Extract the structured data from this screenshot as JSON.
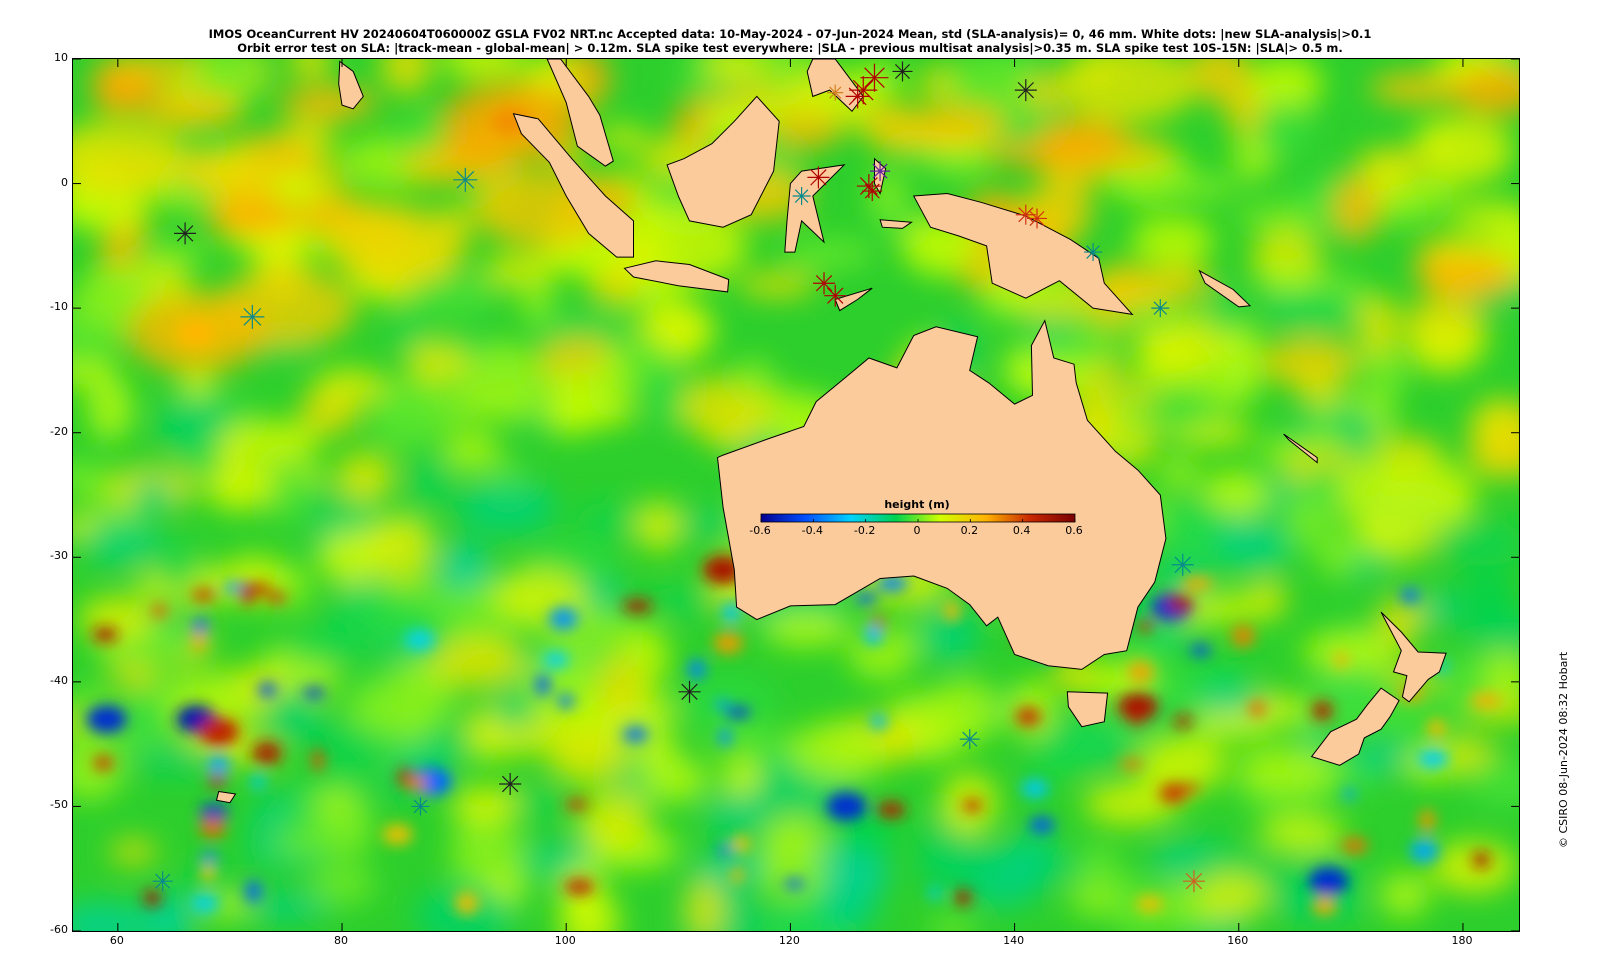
{
  "title": {
    "line1": "IMOS OceanCurrent HV 20240604T060000Z GSLA FV02 NRT.nc  Accepted data: 10-May-2024 - 07-Jun-2024 Mean, std (SLA-analysis)= 0, 46 mm. White dots: |new SLA-analysis|>0.1",
    "line2": "Orbit error test on SLA: |track-mean  - global-mean| > 0.12m.  SLA spike test everywhere: |SLA - previous multisat analysis|>0.35 m. SLA spike test 10S-15N: |SLA|> 0.5 m."
  },
  "axes": {
    "lon_range": [
      56,
      185
    ],
    "lat_range": [
      -60,
      10
    ],
    "x_ticks": [
      "60",
      "80",
      "100",
      "120",
      "140",
      "160",
      "180"
    ],
    "y_ticks": [
      "10",
      "0",
      "-10",
      "-20",
      "-30",
      "-40",
      "-50",
      "-60"
    ]
  },
  "colorbar": {
    "title": "height (m)",
    "ticks": [
      "-0.6",
      "-0.4",
      "-0.2",
      "0",
      "0.2",
      "0.4",
      "0.6"
    ],
    "range": [
      -0.6,
      0.6
    ],
    "colors": [
      "#00008f",
      "#0050ff",
      "#00d2ff",
      "#00d250",
      "#d2ff00",
      "#ffb400",
      "#c82800",
      "#7a0000"
    ]
  },
  "land_color": "#fccb9b",
  "credit": "© CSIRO 08-Jun-2024 08:32 Hobart",
  "chart_data": {
    "type": "heatmap",
    "variable": "sea level anomaly",
    "units": "m",
    "x_range_lon": [
      56,
      185
    ],
    "y_range_lat": [
      -60,
      10
    ],
    "color_range": [
      -0.6,
      0.6
    ],
    "dominant_value": 0,
    "notable_anomalies": [
      {
        "lon": 154,
        "lat": -34,
        "value": -0.5
      },
      {
        "lon": 151,
        "lat": -42,
        "value": 0.5
      },
      {
        "lon": 67,
        "lat": -43,
        "value": -0.55
      },
      {
        "lon": 69,
        "lat": -44,
        "value": 0.45
      },
      {
        "lon": 59,
        "lat": -43,
        "value": -0.5
      },
      {
        "lon": 125,
        "lat": -50,
        "value": -0.5
      },
      {
        "lon": 114,
        "lat": -31,
        "value": 0.5
      },
      {
        "lon": 168,
        "lat": -56,
        "value": -0.5
      },
      {
        "lon": 88,
        "lat": -48,
        "value": -0.4
      },
      {
        "lon": 67,
        "lat": -12,
        "value": 0.25
      },
      {
        "lon": 95,
        "lat": 5,
        "value": 0.3
      }
    ]
  }
}
